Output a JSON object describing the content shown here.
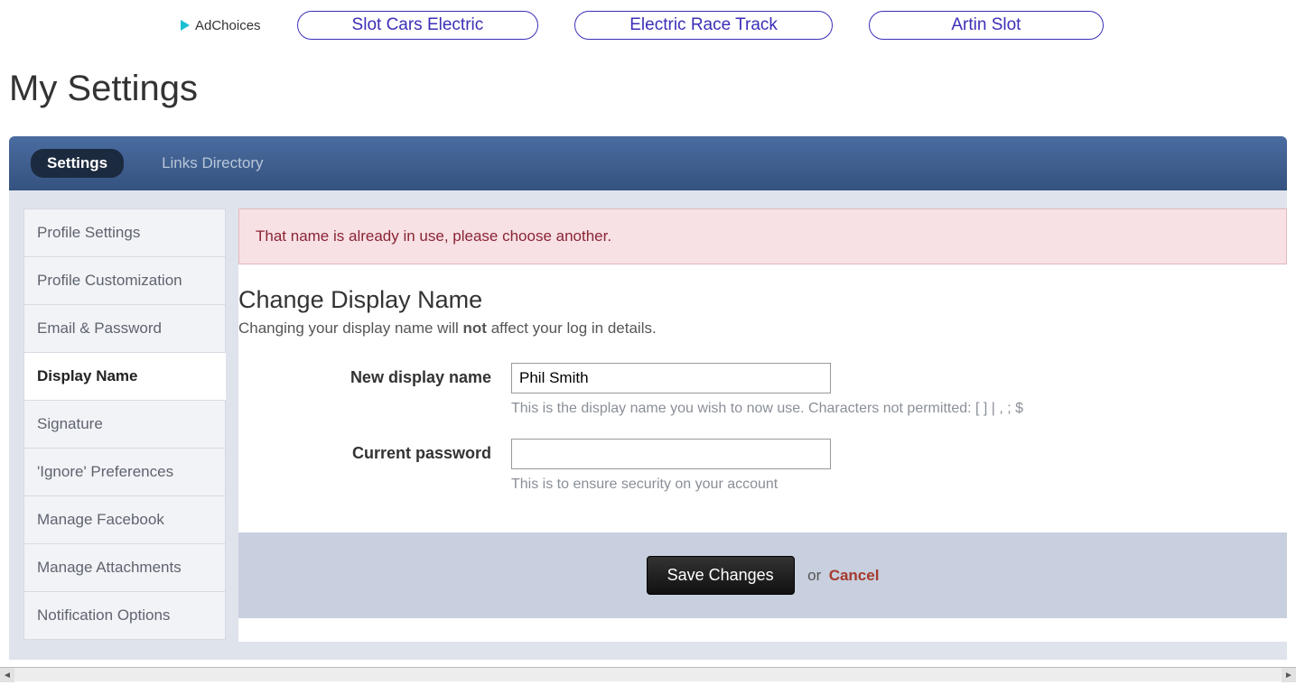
{
  "ads": {
    "adchoices_label": "AdChoices",
    "pills": [
      "Slot Cars Electric",
      "Electric Race Track",
      "Artin Slot"
    ]
  },
  "page_title": "My Settings",
  "tabs": [
    {
      "label": "Settings",
      "active": true
    },
    {
      "label": "Links Directory",
      "active": false
    }
  ],
  "sidebar": {
    "items": [
      {
        "label": "Profile Settings",
        "active": false
      },
      {
        "label": "Profile Customization",
        "active": false
      },
      {
        "label": "Email & Password",
        "active": false
      },
      {
        "label": "Display Name",
        "active": true
      },
      {
        "label": "Signature",
        "active": false
      },
      {
        "label": "'Ignore' Preferences",
        "active": false
      },
      {
        "label": "Manage Facebook",
        "active": false
      },
      {
        "label": "Manage Attachments",
        "active": false
      },
      {
        "label": "Notification Options",
        "active": false
      }
    ]
  },
  "error_message": "That name is already in use, please choose another.",
  "section": {
    "title": "Change Display Name",
    "desc_prefix": "Changing your display name will ",
    "desc_bold": "not",
    "desc_suffix": " affect your log in details."
  },
  "form": {
    "new_name_label": "New display name",
    "new_name_value": "Phil Smith",
    "new_name_help": "This is the display name you wish to now use. Characters not permitted: [ ] | , ; $",
    "password_label": "Current password",
    "password_value": "",
    "password_help": "This is to ensure security on your account"
  },
  "buttons": {
    "save": "Save Changes",
    "or": "or",
    "cancel": "Cancel"
  }
}
